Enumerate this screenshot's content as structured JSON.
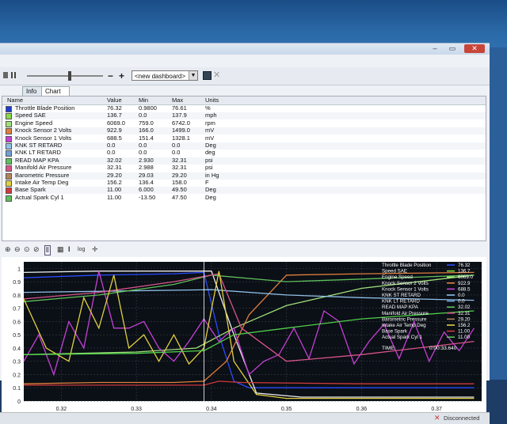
{
  "tabs": [
    {
      "label": "Info"
    },
    {
      "label": "Chart 1"
    }
  ],
  "toolbar": {
    "minus_label": "−",
    "plus_label": "+",
    "dashboard_value": "<new dashboard>",
    "save_icon": "save-icon",
    "clear_icon": "close-icon"
  },
  "table": {
    "headers": [
      "Name",
      "Value",
      "Min",
      "Max",
      "Units"
    ],
    "rows": [
      {
        "name": "Throttle Blade Position",
        "value": "76.32",
        "min": "0.9800",
        "max": "76.61",
        "units": "%",
        "color": "#1f3ccf"
      },
      {
        "name": "Speed SAE",
        "value": "136.7",
        "min": "0.0",
        "max": "137.9",
        "units": "mph",
        "color": "#8ad94a"
      },
      {
        "name": "Engine Speed",
        "value": "6069.0",
        "min": "759.0",
        "max": "6742.0",
        "units": "rpm",
        "color": "#9fe07a"
      },
      {
        "name": "Knock Sensor 2 Volts",
        "value": "922.9",
        "min": "166.0",
        "max": "1499.0",
        "units": "mV",
        "color": "#e07f3c"
      },
      {
        "name": "Knock Sensor 1 Volts",
        "value": "688.5",
        "min": "151.4",
        "max": "1328.1",
        "units": "mV",
        "color": "#c540d6"
      },
      {
        "name": "KNK ST RETARD",
        "value": "0.0",
        "min": "0.0",
        "max": "0.0",
        "units": "Deg",
        "color": "#8fc0e8"
      },
      {
        "name": "KNK LT RETARD",
        "value": "0.0",
        "min": "0.0",
        "max": "0.0",
        "units": "deg",
        "color": "#6f9fd8"
      },
      {
        "name": "READ MAP KPA",
        "value": "32.02",
        "min": "2.930",
        "max": "32.31",
        "units": "psi",
        "color": "#5fbf5a"
      },
      {
        "name": "Manifold Air Pressure",
        "value": "32.31",
        "min": "2.988",
        "max": "32.31",
        "units": "psi",
        "color": "#d8548a"
      },
      {
        "name": "Barometric Pressure",
        "value": "29.20",
        "min": "29.03",
        "max": "29.20",
        "units": "in Hg",
        "color": "#b0865a"
      },
      {
        "name": "Intake Air Temp Deg",
        "value": "156.2",
        "min": "136.4",
        "max": "158.0",
        "units": "F",
        "color": "#e0d040"
      },
      {
        "name": "Base Spark",
        "value": "11.00",
        "min": "6.000",
        "max": "49.50",
        "units": "Deg",
        "color": "#d03a3a"
      },
      {
        "name": "Actual Spark Cyl 1",
        "value": "11.00",
        "min": "-13.50",
        "max": "47.50",
        "units": "Deg",
        "color": "#5fbf5a"
      }
    ]
  },
  "chart_tools": {
    "log_label": "log"
  },
  "chart_data": {
    "type": "line",
    "x_ticks": [
      "0.32",
      "0.33",
      "0.34",
      "0.35",
      "0.36",
      "0.37"
    ],
    "y_ticks": [
      "0",
      "0.1",
      "0.2",
      "0.3",
      "0.4",
      "0.5",
      "0.6",
      "0.7",
      "0.8",
      "0.9",
      "1"
    ],
    "ylim": [
      0,
      1.05
    ],
    "legend": [
      {
        "name": "Throttle Blade Position",
        "value": "76.32",
        "color": "#2a4cff"
      },
      {
        "name": "Speed SAE",
        "value": "136.7",
        "color": "#8ad94a"
      },
      {
        "name": "Engine Speed",
        "value": "6069.0",
        "color": "#9fe07a"
      },
      {
        "name": "Knock Sensor 2 Volts",
        "value": "922.9",
        "color": "#e07f3c"
      },
      {
        "name": "Knock Sensor 1 Volts",
        "value": "688.5",
        "color": "#c540d6"
      },
      {
        "name": "KNK ST RETARD",
        "value": "0.0",
        "color": "#8fc0e8"
      },
      {
        "name": "KNK LT RETARD",
        "value": "0.0",
        "color": "#6f9fd8"
      },
      {
        "name": "READ MAP KPA",
        "value": "32.02",
        "color": "#5fbf5a"
      },
      {
        "name": "Manifold Air Pressure",
        "value": "32.31",
        "color": "#d8548a"
      },
      {
        "name": "Barometric Pressure",
        "value": "29.20",
        "color": "#b0865a"
      },
      {
        "name": "Intake Air Temp Deg",
        "value": "156.2",
        "color": "#e0d040"
      },
      {
        "name": "Base Spark",
        "value": "11.00",
        "color": "#d03a3a"
      },
      {
        "name": "Actual Spark Cyl 1",
        "value": "11.00",
        "color": "#5fbf5a"
      }
    ],
    "time_label": "TIME:",
    "time_value": "0:00:33.640",
    "series": [
      {
        "color": "#2a4cff",
        "x": [
          0.315,
          0.325,
          0.335,
          0.339,
          0.341,
          0.343,
          0.345,
          0.35,
          0.36,
          0.375
        ],
        "y": [
          0.93,
          0.95,
          0.96,
          0.97,
          0.5,
          0.15,
          0.1,
          0.1,
          0.1,
          0.1
        ]
      },
      {
        "color": "#eeeeee",
        "x": [
          0.315,
          0.325,
          0.335,
          0.34,
          0.343,
          0.346,
          0.352,
          0.36,
          0.375
        ],
        "y": [
          0.97,
          0.98,
          0.98,
          0.98,
          0.5,
          0.06,
          0.03,
          0.03,
          0.03
        ]
      },
      {
        "color": "#9fe07a",
        "x": [
          0.315,
          0.33,
          0.338,
          0.343,
          0.35,
          0.36,
          0.375
        ],
        "y": [
          0.35,
          0.37,
          0.4,
          0.55,
          0.72,
          0.85,
          0.95
        ]
      },
      {
        "color": "#e07f3c",
        "x": [
          0.315,
          0.325,
          0.335,
          0.339,
          0.342,
          0.345,
          0.35,
          0.36,
          0.375
        ],
        "y": [
          0.13,
          0.14,
          0.14,
          0.15,
          0.3,
          0.65,
          0.95,
          0.96,
          0.97
        ]
      },
      {
        "color": "#c540d6",
        "x": [
          0.315,
          0.317,
          0.319,
          0.321,
          0.323,
          0.325,
          0.327,
          0.329,
          0.331,
          0.333,
          0.335,
          0.337,
          0.339,
          0.341,
          0.343,
          0.345,
          0.347,
          0.349,
          0.351,
          0.353,
          0.355,
          0.357,
          0.359,
          0.361,
          0.363,
          0.365,
          0.367,
          0.369,
          0.371,
          0.373,
          0.375
        ],
        "y": [
          0.3,
          0.5,
          0.2,
          0.6,
          0.4,
          0.98,
          0.55,
          0.55,
          0.6,
          0.4,
          0.3,
          0.45,
          0.62,
          0.45,
          0.55,
          0.2,
          0.3,
          0.35,
          0.55,
          0.32,
          0.68,
          0.6,
          0.28,
          0.45,
          0.58,
          0.32,
          0.6,
          0.3,
          0.52,
          0.38,
          0.55
        ]
      },
      {
        "color": "#8fc0e8",
        "x": [
          0.315,
          0.34,
          0.35,
          0.36,
          0.375
        ],
        "y": [
          0.82,
          0.84,
          0.8,
          0.78,
          0.76
        ]
      },
      {
        "color": "#5fbf5a",
        "x": [
          0.315,
          0.325,
          0.335,
          0.34,
          0.35,
          0.36,
          0.375
        ],
        "y": [
          0.75,
          0.8,
          0.88,
          0.95,
          0.9,
          0.92,
          0.95
        ]
      },
      {
        "color": "#d8548a",
        "x": [
          0.315,
          0.325,
          0.335,
          0.341,
          0.344,
          0.35,
          0.36,
          0.375
        ],
        "y": [
          0.77,
          0.82,
          0.9,
          0.96,
          0.55,
          0.3,
          0.35,
          0.45
        ]
      },
      {
        "color": "#e0d040",
        "x": [
          0.315,
          0.318,
          0.321,
          0.323,
          0.325,
          0.327,
          0.329,
          0.331,
          0.333,
          0.335,
          0.337,
          0.339,
          0.341,
          0.343,
          0.346,
          0.35,
          0.36,
          0.375
        ],
        "y": [
          0.77,
          0.4,
          0.3,
          0.78,
          0.55,
          0.95,
          0.4,
          0.5,
          0.3,
          0.5,
          0.28,
          0.4,
          0.98,
          0.3,
          0.05,
          0.02,
          0.02,
          0.02
        ]
      },
      {
        "color": "#d03a3a",
        "x": [
          0.315,
          0.33,
          0.339,
          0.341,
          0.344,
          0.36,
          0.375
        ],
        "y": [
          0.12,
          0.12,
          0.12,
          0.15,
          0.14,
          0.13,
          0.13
        ]
      },
      {
        "color": "#4fd04a",
        "x": [
          0.315,
          0.33,
          0.339,
          0.343,
          0.35,
          0.36,
          0.375
        ],
        "y": [
          0.35,
          0.36,
          0.38,
          0.5,
          0.55,
          0.62,
          0.68
        ]
      }
    ]
  },
  "status": {
    "text": "Disconnected"
  }
}
